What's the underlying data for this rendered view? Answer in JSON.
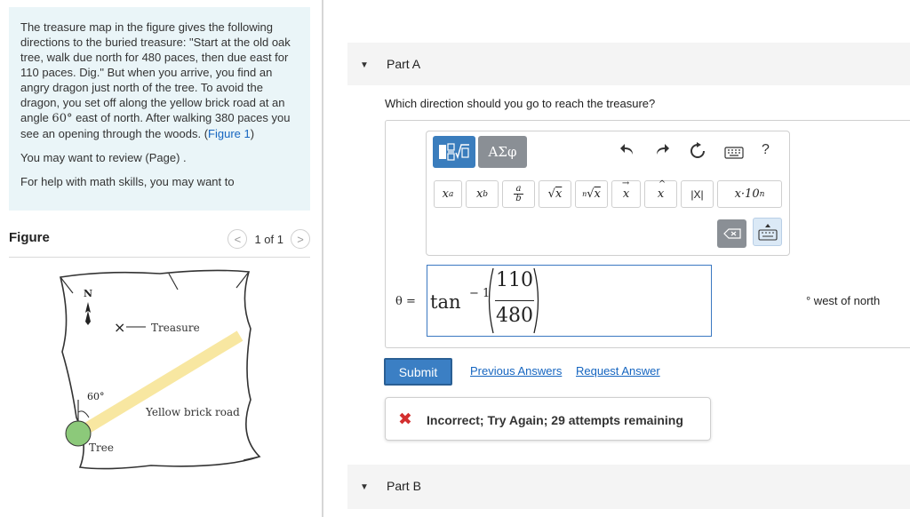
{
  "problem": {
    "paragraph1_before_angle": "The treasure map in the figure gives the following directions to the buried treasure: \"Start at the old oak tree, walk due north for 480 paces, then due east for 110 paces. Dig.\" But when you arrive, you find an angry dragon just north of the tree. To avoid the dragon, you set off along the yellow brick road at an angle ",
    "angle": "60°",
    "paragraph1_after_angle": " east of north. After walking 380 paces you see an opening through the woods. (",
    "figure_link": "Figure 1",
    "paragraph1_end": ")",
    "review_text": "You may want to review (Page) .",
    "help_text": "For help with math skills, you may want to"
  },
  "figure": {
    "title": "Figure",
    "pager_text": "1 of 1",
    "prev_glyph": "<",
    "next_glyph": ">",
    "map": {
      "north_label": "N",
      "treasure_mark": "×",
      "treasure_label": "Treasure",
      "angle_label": "60°",
      "road_label": "Yellow brick road",
      "tree_label": "Tree"
    }
  },
  "partA": {
    "label": "Part A",
    "question": "Which direction should you go to reach the treasure?",
    "toolbar": {
      "greek": "ΑΣφ",
      "help": "?",
      "symbols": [
        "xᵃ",
        "x_b",
        "a/b",
        "√x",
        "ⁿ√x",
        "x⃗",
        "x̂",
        "|X|",
        "x·10ⁿ"
      ]
    },
    "variable": "θ =",
    "answer_func": "tan",
    "answer_exp": "− 1",
    "numerator": "110",
    "denominator": "480",
    "units": "° west of north",
    "submit": "Submit",
    "previous_answers": "Previous Answers",
    "request_answer": "Request Answer",
    "feedback": "Incorrect; Try Again; 29 attempts remaining"
  },
  "partB": {
    "label": "Part B"
  },
  "colors": {
    "accent": "#3b7fc4",
    "link": "#1565c0",
    "error": "#d32f2f",
    "problem_bg": "#eaf5f8",
    "road": "#f8e7a1"
  }
}
